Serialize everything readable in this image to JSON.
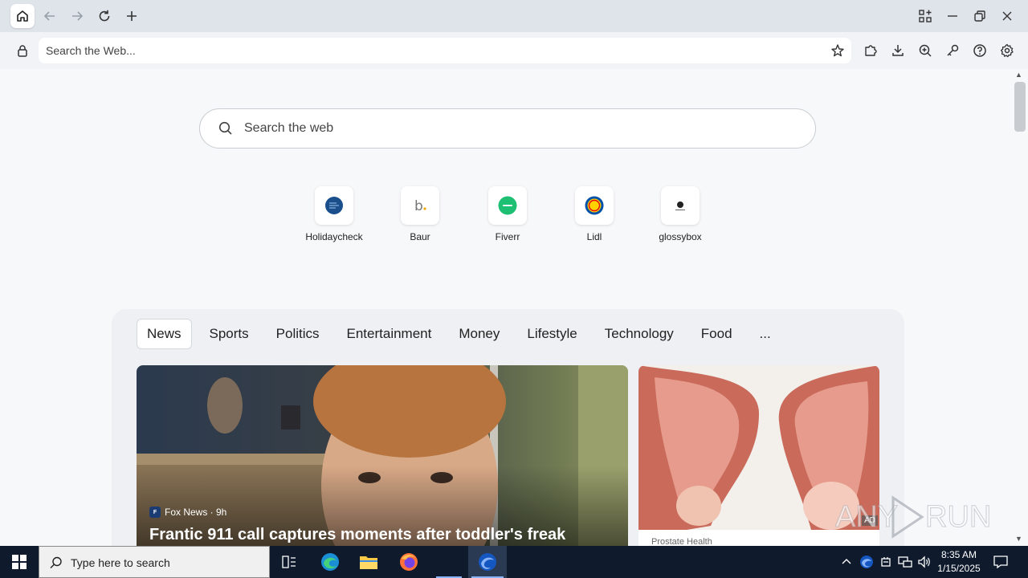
{
  "browser": {
    "address_placeholder": "Search the Web..."
  },
  "newtab": {
    "search_placeholder": "Search the web",
    "shortcuts": [
      {
        "label": "Holidaycheck",
        "color": "#1a4f8c"
      },
      {
        "label": "Baur",
        "color": "#777777"
      },
      {
        "label": "Fiverr",
        "color": "#1dbf73"
      },
      {
        "label": "Lidl",
        "color": "#0050aa"
      },
      {
        "label": "glossybox",
        "color": "#222222"
      }
    ],
    "tabs": [
      "News",
      "Sports",
      "Politics",
      "Entertainment",
      "Money",
      "Lifestyle",
      "Technology",
      "Food",
      "..."
    ],
    "active_tab": "News",
    "main_card": {
      "source": "Fox News · 9h",
      "headline": "Frantic 911 call captures moments after toddler's freak"
    },
    "ad_card": {
      "badge": "AD",
      "source": "Prostate Health"
    }
  },
  "taskbar": {
    "search_placeholder": "Type here to search",
    "time": "8:35 AM",
    "date": "1/15/2025"
  },
  "watermark": {
    "text": "ANY RUN"
  },
  "colors": {
    "titlebar": "#dfe3ea",
    "taskbar": "#0f1b2d",
    "accent": "#8ab4f8"
  }
}
